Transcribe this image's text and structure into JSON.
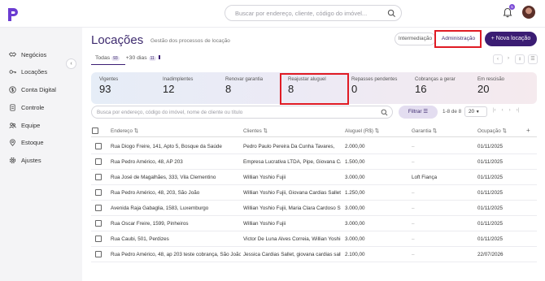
{
  "topbar": {
    "search_placeholder": "Buscar por endereço, cliente, código do imóvel...",
    "notification_count": "5"
  },
  "sidebar": {
    "items": [
      {
        "label": "Negócios",
        "icon": "handshake-icon"
      },
      {
        "label": "Locações",
        "icon": "key-icon"
      },
      {
        "label": "Conta Digital",
        "icon": "dollar-circle-icon"
      },
      {
        "label": "Controle",
        "icon": "document-icon"
      },
      {
        "label": "Equipe",
        "icon": "team-icon"
      },
      {
        "label": "Estoque",
        "icon": "location-pin-icon"
      },
      {
        "label": "Ajustes",
        "icon": "gear-icon"
      }
    ]
  },
  "header": {
    "title": "Locações",
    "subtitle": "Gestão dos processos de locação",
    "btn_intermediacao": "Intermediação",
    "btn_administracao": "Administração",
    "btn_nova": "+ Nova locação"
  },
  "tabs": [
    {
      "label": "Todas",
      "count": "93"
    },
    {
      "label": "+30 dias",
      "count": "11"
    }
  ],
  "stats": [
    {
      "label": "Vigentes",
      "value": "93"
    },
    {
      "label": "Inadimplentes",
      "value": "12"
    },
    {
      "label": "Renovar garantia",
      "value": "8"
    },
    {
      "label": "Reajustar aluguel",
      "value": "8"
    },
    {
      "label": "Repasses pendentes",
      "value": "0"
    },
    {
      "label": "Cobranças a gerar",
      "value": "16"
    },
    {
      "label": "Em rescisão",
      "value": "20"
    }
  ],
  "filter": {
    "search_placeholder": "Busca por endereço, código do imóvel, nome de cliente ou título",
    "filter_label": "Filtrar",
    "pagination_text": "1-8 de 8",
    "page_size": "20"
  },
  "table": {
    "headers": [
      "Endereço",
      "Clientes",
      "Aluguel (R$)",
      "Garantia",
      "Ocupação"
    ],
    "rows": [
      [
        "Rua Diogo Freire, 141, Apto 5, Bosque da Saúde",
        "Pedro Paulo Pereira Da Cunha Tavares,",
        "2.000,00",
        "–",
        "01/11/2025"
      ],
      [
        "Rua Pedro Américo, 48, AP 203",
        "Empresa Lucrativa LTDA, Pipe, Giovana Car...",
        "1.500,00",
        "–",
        "01/11/2025"
      ],
      [
        "Rua José de Magalhães, 333, Vila Clementino",
        "Willian Yoshio Fujii",
        "3.000,00",
        "Loft Fiança",
        "01/11/2025"
      ],
      [
        "Rua Pedro Américo, 48, 203, São João",
        "Willian Yoshio Fujii, Giovana Cardias Sallet,...",
        "1.250,00",
        "–",
        "01/11/2025"
      ],
      [
        "Avenida Raja Gabaglia, 1583, Luxemburgo",
        "Willian Yoshio Fujii, Maria Clara Cardoso Si...",
        "3.000,00",
        "–",
        "01/11/2025"
      ],
      [
        "Rua Oscar Freire, 1599, Pinheiros",
        "Willian Yoshio Fujii",
        "3.000,00",
        "–",
        "01/11/2025"
      ],
      [
        "Rua Caubi, 501, Perdizes",
        "Victor De Luna Alves Correia, Willian Yoshio ...",
        "3.000,00",
        "–",
        "01/11/2025"
      ],
      [
        "Rua Pedro Américo, 48, ap 203 teste cobrança, São João",
        "Jessica Cardias Sallet, giovana cardias sall...",
        "2.100,00",
        "–",
        "22/07/2026"
      ]
    ]
  }
}
